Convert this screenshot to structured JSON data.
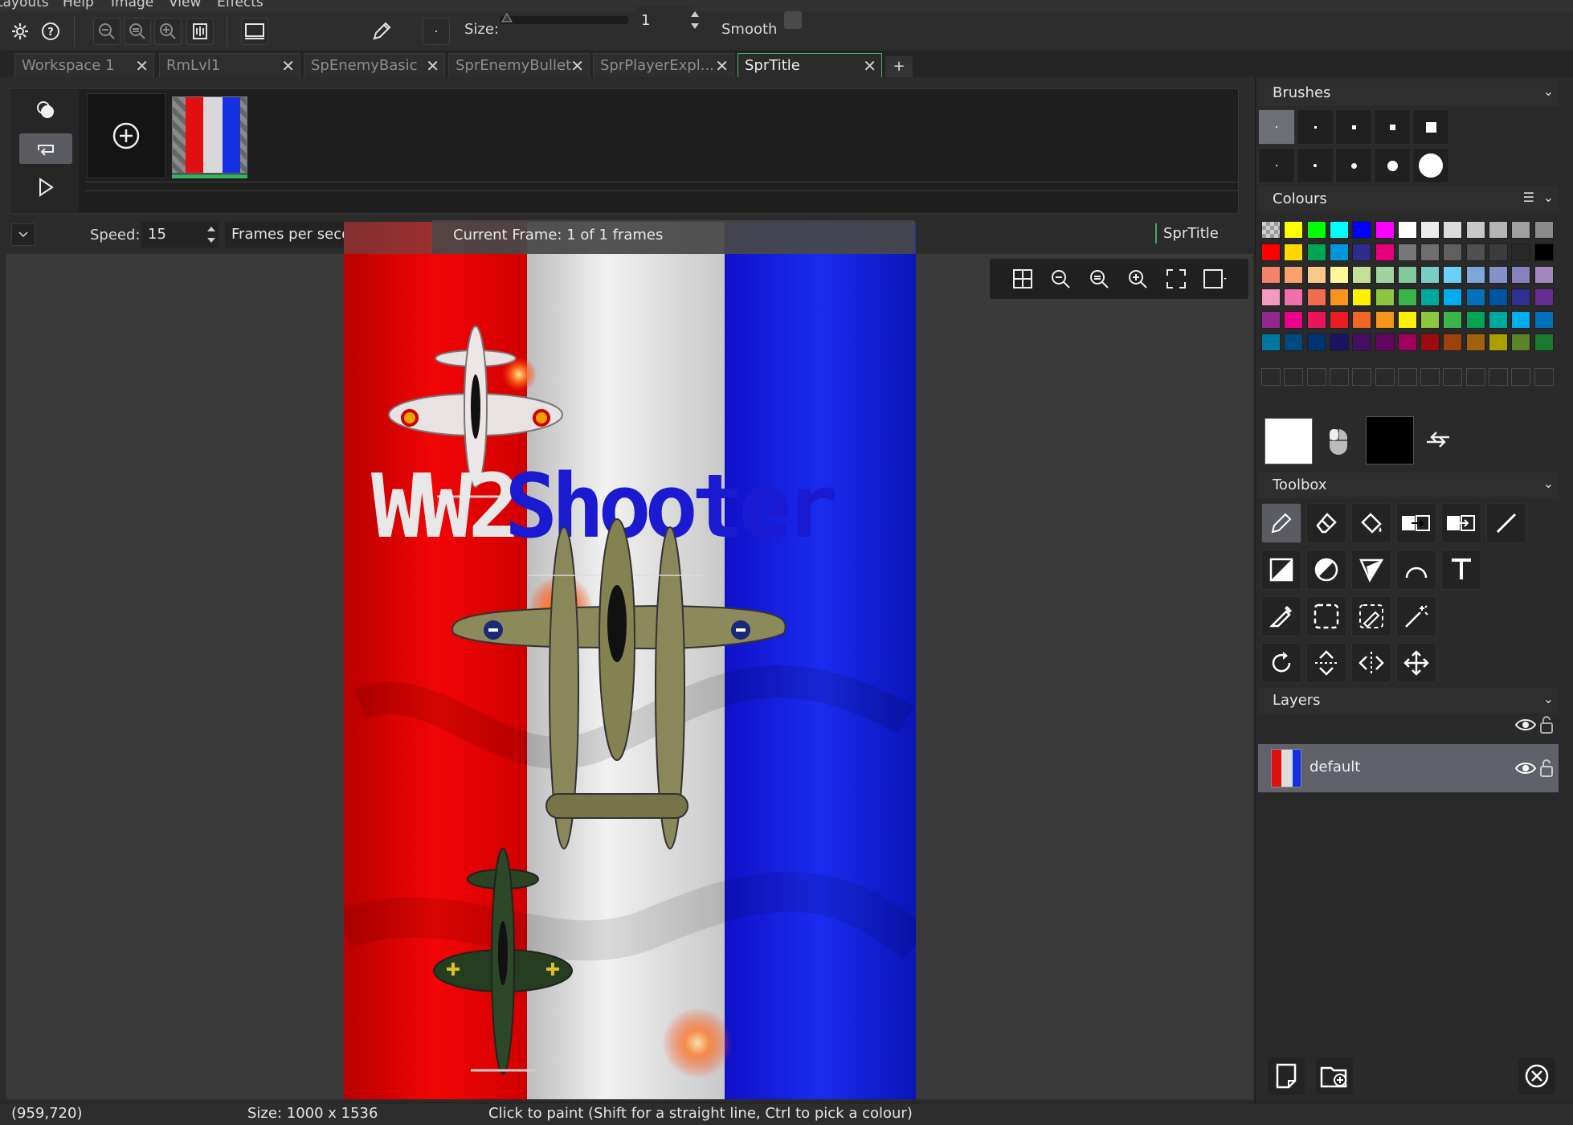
{
  "menu": {
    "items": [
      "Layouts",
      "Help",
      "Image",
      "View",
      "Effects"
    ]
  },
  "toolbar": {
    "size_label": "Size:",
    "size_value": "1",
    "smooth_label": "Smooth"
  },
  "tabs": [
    {
      "label": "Workspace 1",
      "active": false
    },
    {
      "label": "RmLvl1",
      "active": false
    },
    {
      "label": "SpEnemyBasic",
      "active": false
    },
    {
      "label": "SprEnemyBullet",
      "active": false
    },
    {
      "label": "SprPlayerExpl...",
      "active": false
    },
    {
      "label": "SprTitle",
      "active": true
    }
  ],
  "tab_add_label": "+",
  "speed": {
    "label": "Speed:",
    "value": "15",
    "unit": "Frames per second"
  },
  "current_frame": "Current Frame: 1 of 1 frames",
  "sprite_name": "SprTitle",
  "sprite": {
    "title_part1": "WW2",
    "title_part2": "Shooter"
  },
  "panels": {
    "brushes": "Brushes",
    "colours": "Colours",
    "toolbox": "Toolbox",
    "layers": "Layers"
  },
  "colour_rows": [
    [
      "checker",
      "#ffff00",
      "#00ff00",
      "#00ffff",
      "#0000ff",
      "#ff00ff",
      "#ffffff",
      "#ebebeb",
      "#dcdcdc",
      "#c8c8c8",
      "#b4b4b4",
      "#a0a0a0",
      "#8c8c8c"
    ],
    [
      "#ff0000",
      "#ffd800",
      "#00a650",
      "#0096dc",
      "#2c2c8c",
      "#e6007e",
      "#787878",
      "#6e6e6e",
      "#5f5f5f",
      "#505050",
      "#3c3c3c",
      "#282828",
      "#000000"
    ],
    [
      "#f4836b",
      "#f8a26b",
      "#fbc88a",
      "#fff89a",
      "#c4df9b",
      "#a3d39c",
      "#82ca9c",
      "#7accc8",
      "#6dcff6",
      "#7da7d9",
      "#8393ca",
      "#8781bd",
      "#a187be"
    ],
    [
      "#f49ac1",
      "#f06eaa",
      "#f26c4f",
      "#f7941d",
      "#fff200",
      "#8dc63f",
      "#39b54a",
      "#00a99d",
      "#00aeef",
      "#0072bc",
      "#0054a6",
      "#2e3192",
      "#662d91"
    ],
    [
      "#92278f",
      "#ec008c",
      "#ed145b",
      "#ed1c24",
      "#f26522",
      "#f7941d",
      "#fff200",
      "#8dc63f",
      "#39b54a",
      "#00a651",
      "#00a99d",
      "#00aeef",
      "#0072bc"
    ],
    [
      "#0076a3",
      "#004a80",
      "#003471",
      "#1b1464",
      "#440e62",
      "#630460",
      "#9e005d",
      "#9e0b0f",
      "#a0410d",
      "#a36209",
      "#aba000",
      "#598527",
      "#1a7b30"
    ]
  ],
  "colours": {
    "primary": "#ffffff",
    "secondary": "#000000",
    "accent": "#3fa865"
  },
  "layers": [
    {
      "name": "default",
      "visible": true
    }
  ],
  "status": {
    "coords": "(959,720)",
    "size": "Size: 1000 x 1536",
    "hint": "Click to paint (Shift for a straight line, Ctrl to pick a colour)"
  }
}
